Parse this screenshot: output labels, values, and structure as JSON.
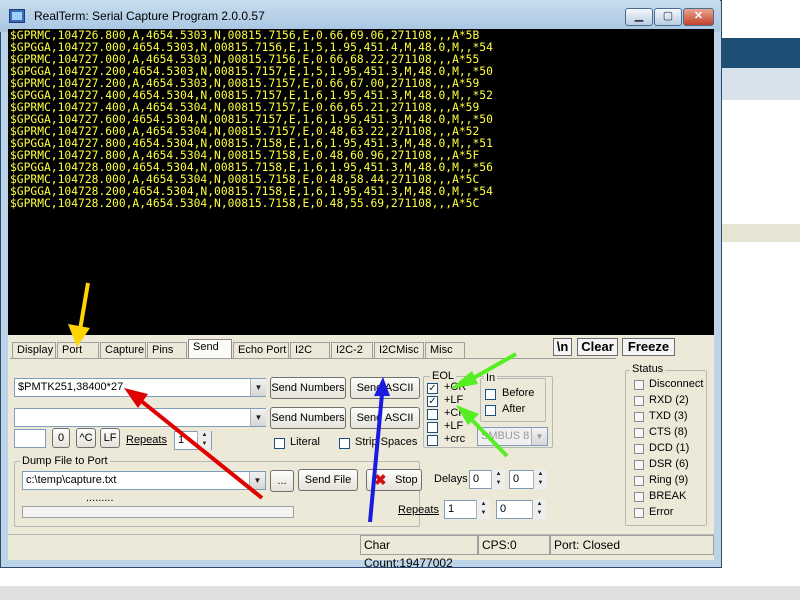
{
  "window": {
    "title": "RealTerm: Serial Capture Program 2.0.0.57",
    "minimize": "▁",
    "maximize": "▢",
    "close": "✕"
  },
  "terminal_lines": [
    "$GPRMC,104726.800,A,4654.5303,N,00815.7156,E,0.66,69.06,271108,,,A*5B",
    "$GPGGA,104727.000,4654.5303,N,00815.7156,E,1,5,1.95,451.4,M,48.0,M,,*54",
    "$GPRMC,104727.000,A,4654.5303,N,00815.7156,E,0.66,68.22,271108,,,A*55",
    "$GPGGA,104727.200,4654.5303,N,00815.7157,E,1,5,1.95,451.3,M,48.0,M,,*50",
    "$GPRMC,104727.200,A,4654.5303,N,00815.7157,E,0.66,67.00,271108,,,A*59",
    "$GPGGA,104727.400,4654.5304,N,00815.7157,E,1,6,1.95,451.3,M,48.0,M,,*52",
    "$GPRMC,104727.400,A,4654.5304,N,00815.7157,E,0.66,65.21,271108,,,A*59",
    "$GPGGA,104727.600,4654.5304,N,00815.7157,E,1,6,1.95,451.3,M,48.0,M,,*50",
    "$GPRMC,104727.600,A,4654.5304,N,00815.7157,E,0.48,63.22,271108,,,A*52",
    "$GPGGA,104727.800,4654.5304,N,00815.7158,E,1,6,1.95,451.3,M,48.0,M,,*51",
    "$GPRMC,104727.800,A,4654.5304,N,00815.7158,E,0.48,60.96,271108,,,A*5F",
    "$GPGGA,104728.000,4654.5304,N,00815.7158,E,1,6,1.95,451.3,M,48.0,M,,*56",
    "$GPRMC,104728.000,A,4654.5304,N,00815.7158,E,0.48,58.44,271108,,,A*5C",
    "$GPGGA,104728.200,4654.5304,N,00815.7158,E,1,6,1.95,451.3,M,48.0,M,,*54",
    "$GPRMC,104728.200,A,4654.5304,N,00815.7158,E,0.48,55.69,271108,,,A*5C"
  ],
  "tabs": [
    "Display",
    "Port",
    "Capture",
    "Pins",
    "Send",
    "Echo Port",
    "I2C",
    "I2C-2",
    "I2CMisc",
    "Misc"
  ],
  "active_tab": "Send",
  "toolbar": {
    "newline": "\\n",
    "clear": "Clear",
    "freeze": "Freeze"
  },
  "send": {
    "input1_value": "$PMTK251,38400*27",
    "input2_value": "",
    "send_numbers_1": "Send Numbers",
    "send_ascii_1": "Send ASCII",
    "send_numbers_2": "Send Numbers",
    "send_ascii_2": "Send ASCII",
    "char_field": "",
    "zero_btn": "0",
    "ctrl_c_btn": "^C",
    "lf_btn": "LF",
    "repeats_label": "Repeats",
    "repeats_value": "1",
    "literal_label": "Literal",
    "strip_spaces_label": "Strip Spaces"
  },
  "eol": {
    "title": "EOL",
    "items": [
      {
        "label": "+CR",
        "checked": true
      },
      {
        "label": "+LF",
        "checked": true
      },
      {
        "label": "+CR",
        "checked": false
      },
      {
        "label": "+LF",
        "checked": false
      },
      {
        "label": "+crc",
        "checked": false
      }
    ],
    "in_label": "In",
    "before_label": "Before",
    "after_label": "After",
    "smbus_value": "SMBUS 8"
  },
  "dump": {
    "title": "Dump File to Port",
    "path": "c:\\temp\\capture.txt",
    "browse": "...",
    "send_file": "Send File",
    "stop": "Stop",
    "delays_label": "Delays",
    "delay1": "0",
    "delay2": "0",
    "repeats_label": "Repeats",
    "repeats1": "1",
    "repeats2": "0",
    "dots": "........."
  },
  "status": {
    "title": "Status",
    "items": [
      "Disconnect",
      "RXD (2)",
      "TXD (3)",
      "CTS (8)",
      "DCD (1)",
      "DSR (6)",
      "Ring (9)",
      "BREAK",
      "Error"
    ]
  },
  "statusbar": {
    "char_count": "Char Count:19477002",
    "cps": "CPS:0",
    "port": "Port: Closed"
  },
  "colors": {
    "terminal_bg": "#000000",
    "terminal_text": "#ffff40",
    "arrow_yellow": "#ffd400",
    "arrow_red": "#e00000",
    "arrow_blue": "#1a1ae0",
    "arrow_green": "#55ee22"
  }
}
